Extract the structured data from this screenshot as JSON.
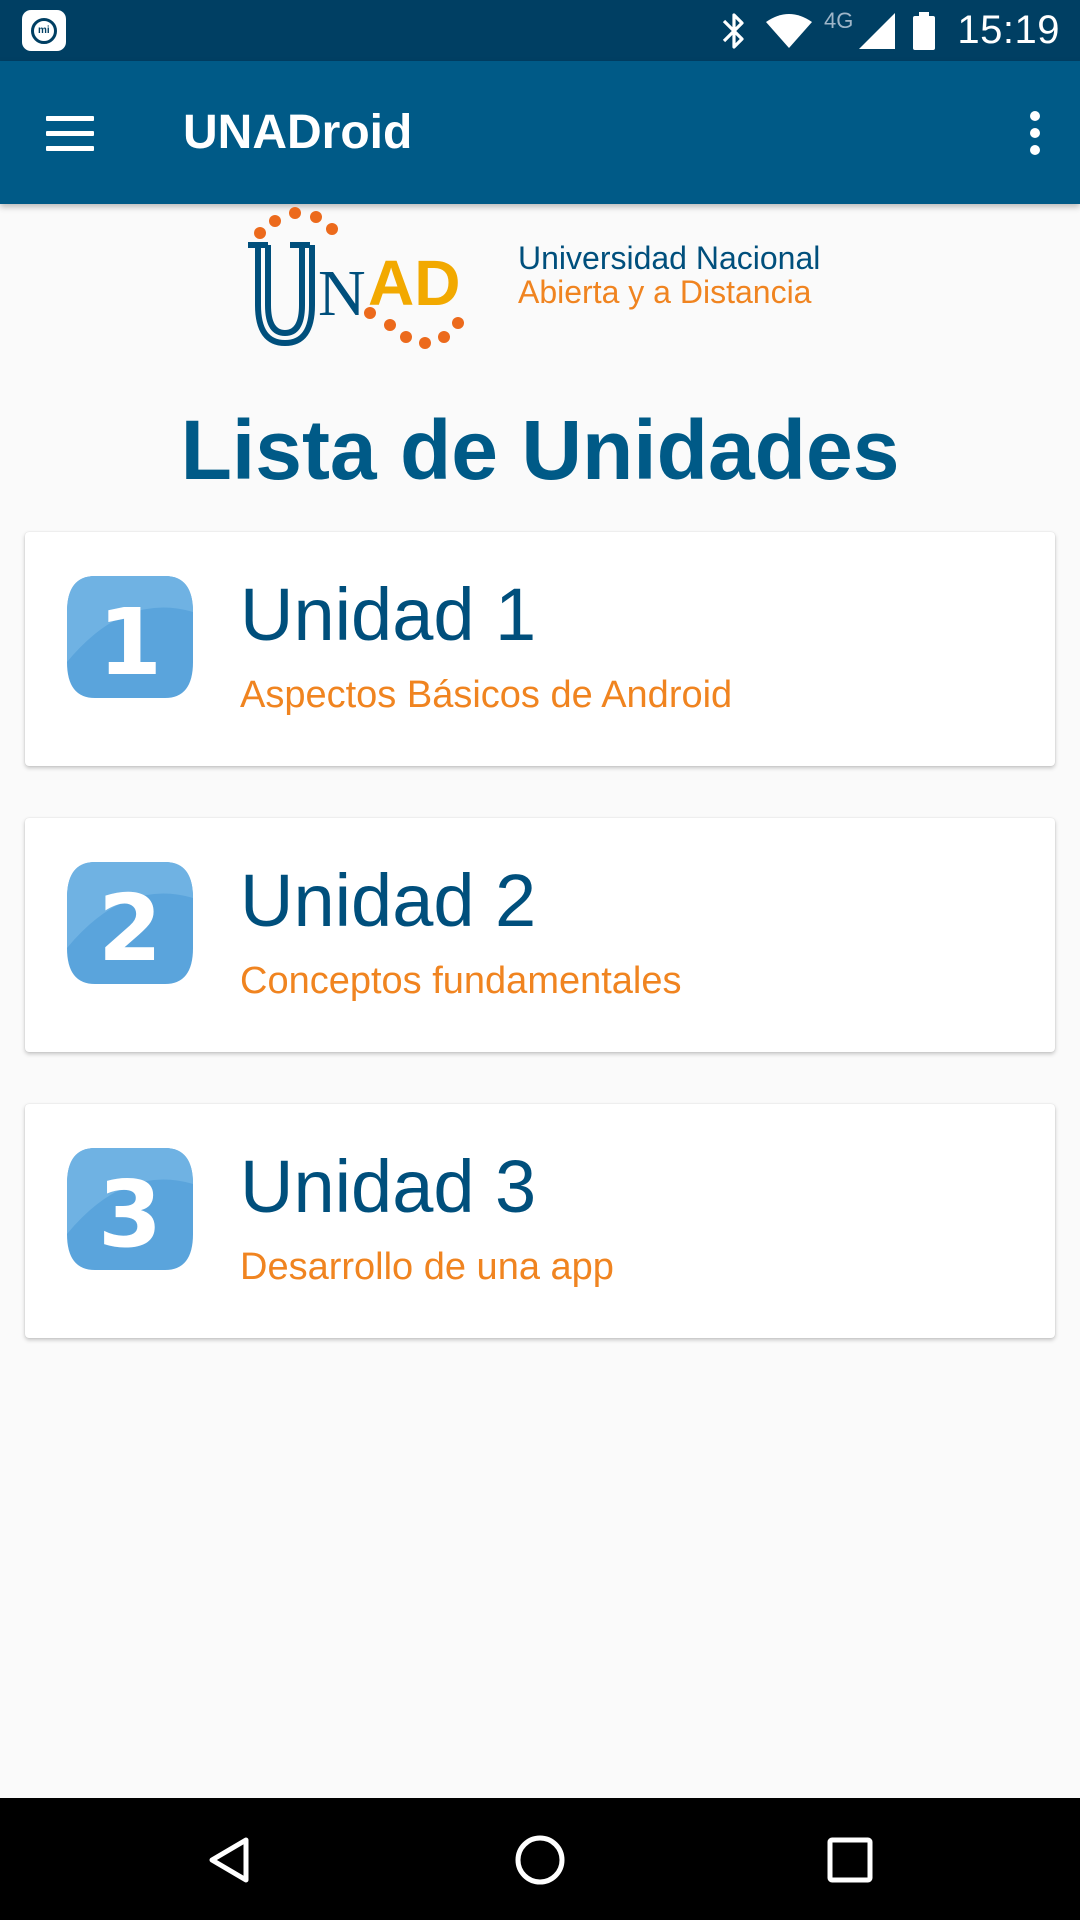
{
  "status_bar": {
    "network": "4G",
    "time": "15:19",
    "icons": [
      "mi-app-icon",
      "bluetooth-icon",
      "wifi-icon",
      "cell-signal-icon",
      "battery-icon"
    ]
  },
  "app_bar": {
    "title": "UNADroid",
    "menu_icon": "hamburger-menu-icon",
    "overflow_icon": "more-vert-icon",
    "color": "#005a87"
  },
  "logo": {
    "line1": "Universidad Nacional",
    "line2": "Abierta y a Distancia",
    "letters_un": "UN",
    "letters_ad": "AD"
  },
  "page_title": "Lista de Unidades",
  "units": [
    {
      "number": "1",
      "title": "Unidad 1",
      "subtitle": "Aspectos Básicos de Android"
    },
    {
      "number": "2",
      "title": "Unidad 2",
      "subtitle": "Conceptos fundamentales"
    },
    {
      "number": "3",
      "title": "Unidad 3",
      "subtitle": "Desarrollo de una app"
    }
  ],
  "colors": {
    "primary": "#005a87",
    "status_bar": "#003f63",
    "accent_orange": "#f08420",
    "badge_blue": "#5aa4dc"
  },
  "nav_bar": {
    "icons": [
      "back-icon",
      "home-icon",
      "recents-icon"
    ]
  }
}
